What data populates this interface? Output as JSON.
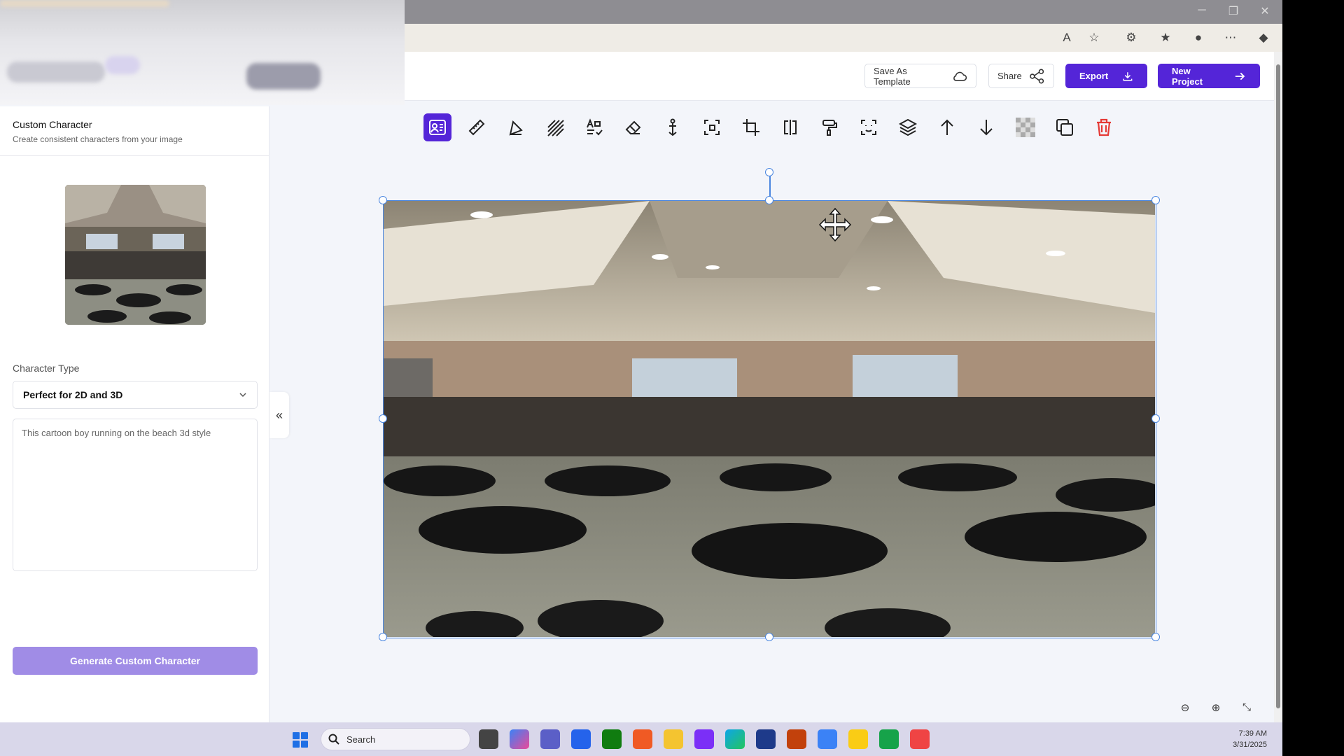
{
  "toolbar_top": {
    "save_template": "Save As Template",
    "share": "Share",
    "export": "Export",
    "new_project": "New Project"
  },
  "sidebar": {
    "title": "Custom Character",
    "subtitle": "Create consistent characters from your image",
    "character_type_label": "Character Type",
    "character_type_value": "Perfect for 2D and 3D",
    "prompt_text": "This cartoon boy running on the beach 3d style",
    "generate_label": "Generate Custom Character",
    "collapse_glyph": "«"
  },
  "tools": [
    "custom-character-icon",
    "ruler-icon",
    "shapes-icon",
    "hatch-icon",
    "text-style-icon",
    "eraser-icon",
    "anchor-icon",
    "select-region-icon",
    "crop-icon",
    "flip-icon",
    "paint-roller-icon",
    "face-scan-icon",
    "layers-icon",
    "arrow-up-icon",
    "arrow-down-icon",
    "transparency-icon",
    "duplicate-icon",
    "delete-icon"
  ],
  "colors": {
    "accent": "#5425d8",
    "accent_light": "#a08ce6",
    "selection": "#4a86e0",
    "delete": "#e53935"
  },
  "taskbar": {
    "search_placeholder": "Search",
    "time": "7:39 AM",
    "date": "3/31/2025"
  }
}
